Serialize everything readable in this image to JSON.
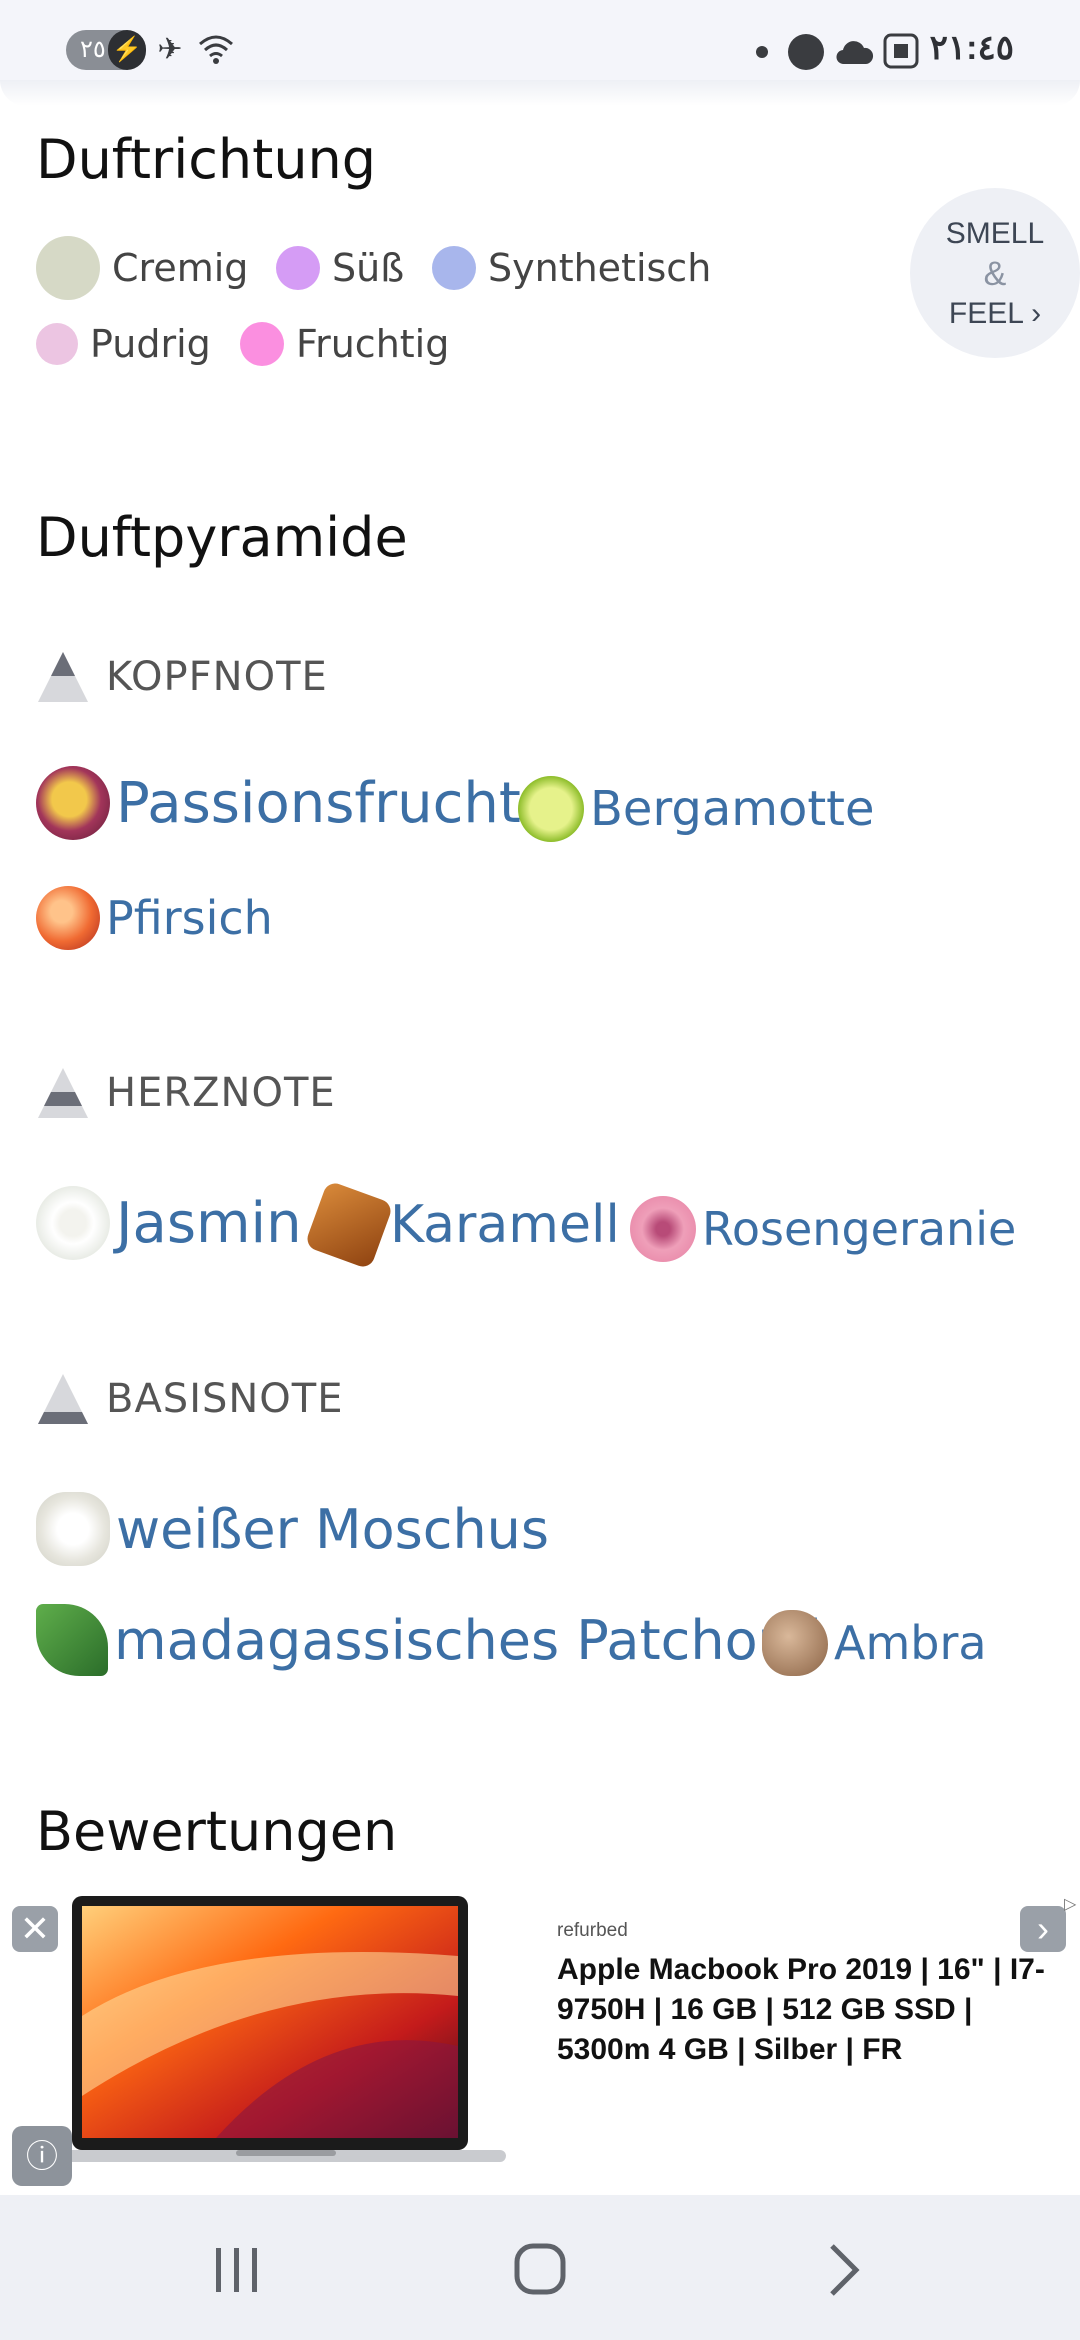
{
  "status_bar": {
    "time": "٢١:٤٥",
    "battery": "٢٥",
    "icons": [
      "battery-icon",
      "airplane-icon",
      "wifi-icon",
      "dot-icon",
      "messenger-icon",
      "cloud-icon",
      "screenshot-icon"
    ]
  },
  "accords": {
    "heading": "Duftrichtung",
    "items": [
      {
        "label": "Cremig",
        "color": "#d6d9c6"
      },
      {
        "label": "Süß",
        "color": "#d59cf5"
      },
      {
        "label": "Synthetisch",
        "color": "#a8b6ec"
      },
      {
        "label": "Pudrig",
        "color": "#ecc5e2"
      },
      {
        "label": "Fruchtig",
        "color": "#fb8fe0"
      }
    ],
    "smell_feel": {
      "line1": "SMELL",
      "line2": "&",
      "line3": "FEEL ›"
    }
  },
  "pyramid": {
    "heading": "Duftpyramide",
    "top": {
      "label": "KOPFNOTE",
      "notes": [
        {
          "name": "Passionsfrucht",
          "icon": "passion-fruit-icon"
        },
        {
          "name": "Bergamotte",
          "icon": "bergamot-icon"
        },
        {
          "name": "Pfirsich",
          "icon": "peach-icon"
        }
      ]
    },
    "heart": {
      "label": "HERZNOTE",
      "notes": [
        {
          "name": "Jasmin",
          "icon": "jasmine-icon"
        },
        {
          "name": "Karamell",
          "icon": "caramel-icon"
        },
        {
          "name": "Rosengeranie",
          "icon": "rose-geranium-icon"
        }
      ]
    },
    "base": {
      "label": "BASISNOTE",
      "notes": [
        {
          "name": "weißer Moschus",
          "icon": "white-musk-icon"
        },
        {
          "name": "madagassisches Patchouli",
          "icon": "patchouli-icon"
        },
        {
          "name": "Ambra",
          "icon": "amber-icon"
        }
      ]
    }
  },
  "reviews": {
    "heading": "Bewertungen"
  },
  "ad": {
    "tag": "refurbed",
    "title": "Apple Macbook Pro 2019 | 16\" | I7-9750H | 16 GB | 512 GB SSD | 5300m 4 GB | Silber | FR"
  }
}
